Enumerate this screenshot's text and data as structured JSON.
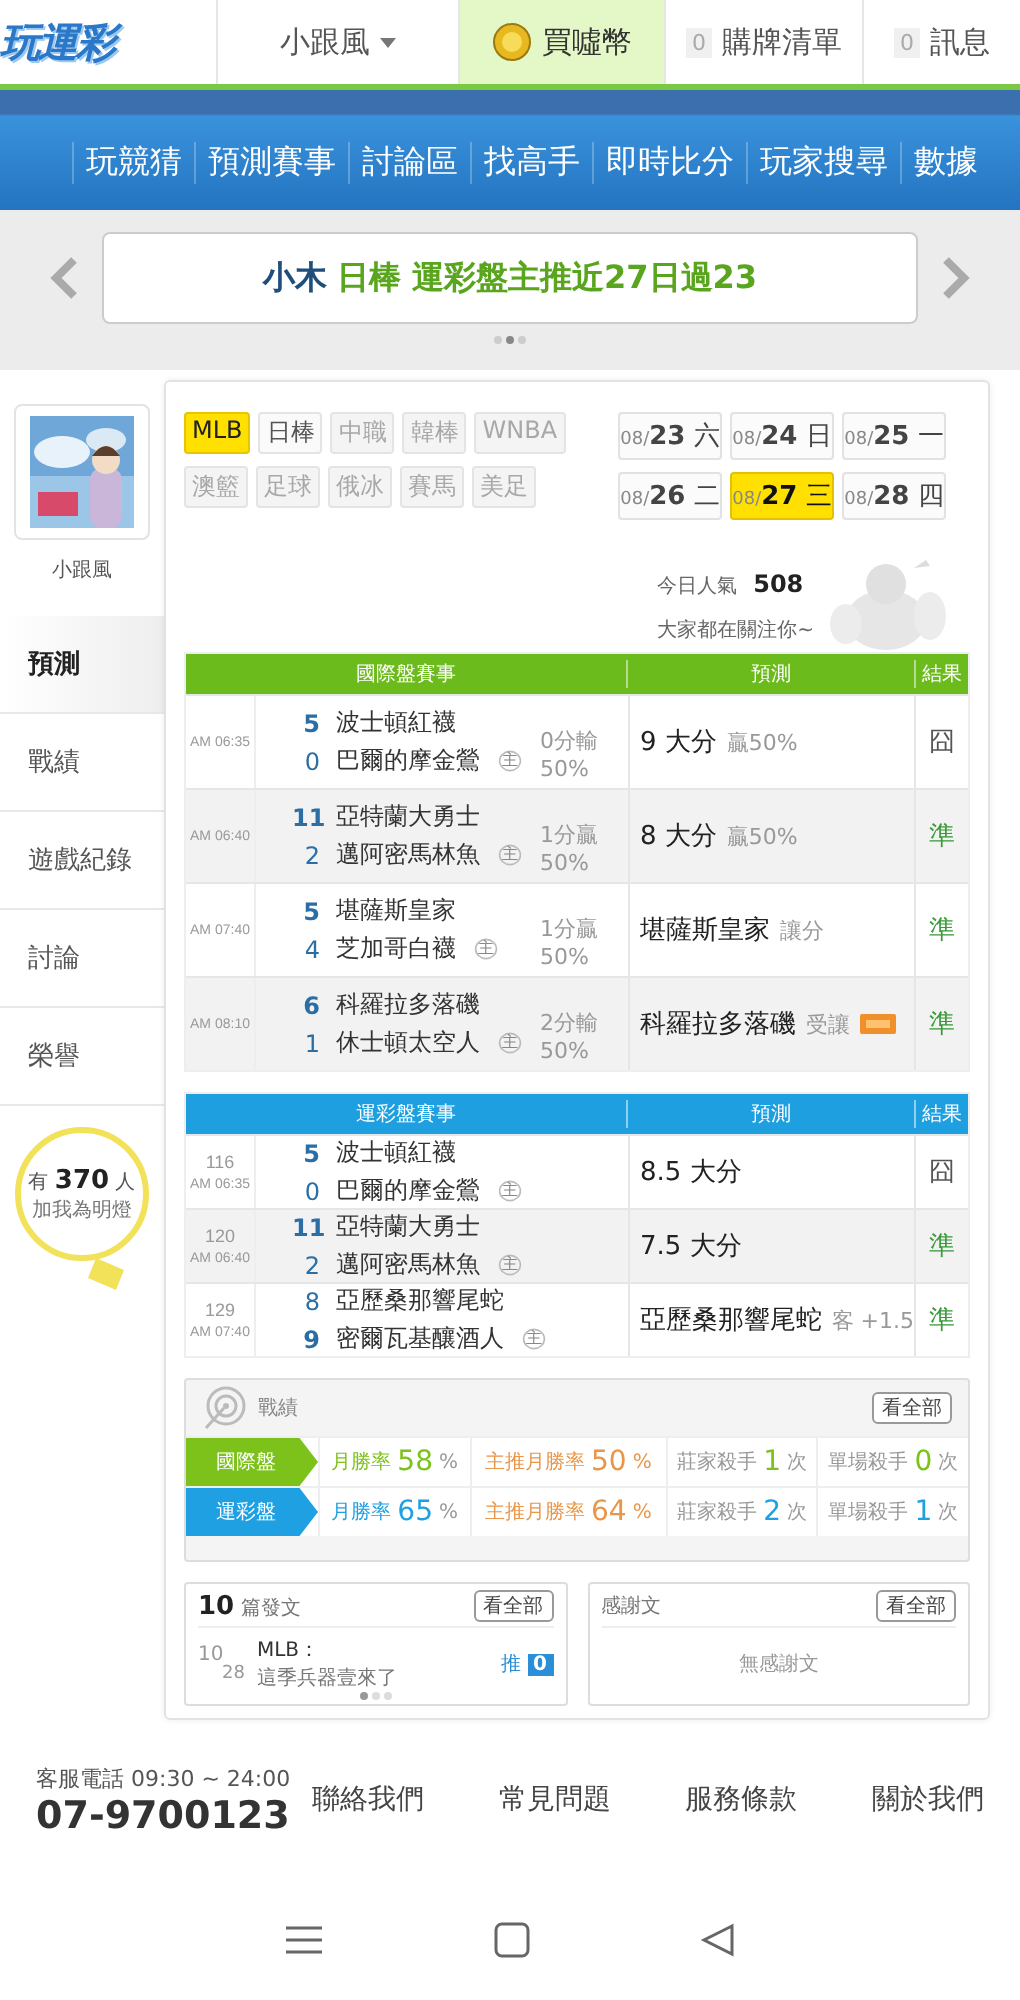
{
  "header": {
    "logo": "玩運彩",
    "user": "小跟風",
    "buy_coins": "買噓幣",
    "cart": {
      "count": "0",
      "label": "購牌清單"
    },
    "messages": {
      "count": "0",
      "label": "訊息"
    }
  },
  "nav": [
    "玩競猜",
    "預測賽事",
    "討論區",
    "找高手",
    "即時比分",
    "玩家搜尋",
    "數據"
  ],
  "banner": {
    "name": "小木",
    "text": "日棒 運彩盤主推近27日過23",
    "dots": [
      {
        "selected": false
      },
      {
        "selected": true
      },
      {
        "selected": false
      }
    ]
  },
  "profile": {
    "name": "小跟風",
    "menu": [
      {
        "label": "預測",
        "selected": true
      },
      {
        "label": "戰績",
        "selected": false
      },
      {
        "label": "遊戲紀錄",
        "selected": false
      },
      {
        "label": "討論",
        "selected": false
      },
      {
        "label": "榮譽",
        "selected": false
      }
    ],
    "fans": {
      "prefix": "有",
      "count": "370",
      "suffix": "人",
      "label": "加我為明燈"
    }
  },
  "sports": [
    {
      "label": "MLB",
      "selected": true,
      "disabled": false
    },
    {
      "label": "日棒",
      "selected": false,
      "disabled": false
    },
    {
      "label": "中職",
      "selected": false,
      "disabled": true
    },
    {
      "label": "韓棒",
      "selected": false,
      "disabled": true
    },
    {
      "label": "WNBA",
      "selected": false,
      "disabled": true
    },
    {
      "label": "澳籃",
      "selected": false,
      "disabled": true
    },
    {
      "label": "足球",
      "selected": false,
      "disabled": true
    },
    {
      "label": "俄冰",
      "selected": false,
      "disabled": true
    },
    {
      "label": "賽馬",
      "selected": false,
      "disabled": true
    },
    {
      "label": "美足",
      "selected": false,
      "disabled": true
    }
  ],
  "dates": [
    {
      "month": "08/",
      "day": "23",
      "weekday": "六",
      "selected": false
    },
    {
      "month": "08/",
      "day": "24",
      "weekday": "日",
      "selected": false
    },
    {
      "month": "08/",
      "day": "25",
      "weekday": "一",
      "selected": false
    },
    {
      "month": "08/",
      "day": "26",
      "weekday": "二",
      "selected": false
    },
    {
      "month": "08/",
      "day": "27",
      "weekday": "三",
      "selected": true
    },
    {
      "month": "08/",
      "day": "28",
      "weekday": "四",
      "selected": false
    }
  ],
  "popularity": {
    "label": "今日人氣",
    "count": "508",
    "note": "大家都在關注你~"
  },
  "intl_table": {
    "color": "#6cbb1c",
    "columns": [
      "國際盤賽事",
      "預測",
      "結果"
    ],
    "rows": [
      {
        "time": "AM 06:35",
        "teams": [
          {
            "score": "5",
            "name": "波士頓紅襪",
            "winner": true
          },
          {
            "score": "0",
            "name": "巴爾的摩金鶯",
            "winner": false,
            "home_mark": "主"
          }
        ],
        "line": "0分輸",
        "odds": "50%",
        "pick": "9 大分",
        "pick_note": "贏50%",
        "result": "囧",
        "correct": false
      },
      {
        "time": "AM 06:40",
        "teams": [
          {
            "score": "11",
            "name": "亞特蘭大勇士",
            "winner": true
          },
          {
            "score": "2",
            "name": "邁阿密馬林魚",
            "winner": false,
            "home_mark": "主"
          }
        ],
        "line": "1分贏",
        "odds": "50%",
        "pick": "8 大分",
        "pick_note": "贏50%",
        "result": "準",
        "correct": true
      },
      {
        "time": "AM 07:40",
        "teams": [
          {
            "score": "5",
            "name": "堪薩斯皇家",
            "winner": true
          },
          {
            "score": "4",
            "name": "芝加哥白襪",
            "winner": false,
            "home_mark": "主"
          }
        ],
        "line": "1分贏",
        "odds": "50%",
        "pick": "堪薩斯皇家",
        "pick_note": "讓分",
        "result": "準",
        "correct": true
      },
      {
        "time": "AM 08:10",
        "teams": [
          {
            "score": "6",
            "name": "科羅拉多落磯",
            "winner": true
          },
          {
            "score": "1",
            "name": "休士頓太空人",
            "winner": false,
            "home_mark": "主"
          }
        ],
        "line": "2分輸",
        "odds": "50%",
        "pick": "科羅拉多落磯",
        "pick_note": "受讓",
        "badge": true,
        "result": "準",
        "correct": true
      }
    ]
  },
  "lottery_table": {
    "color": "#1e9fe0",
    "columns": [
      "運彩盤賽事",
      "預測",
      "結果"
    ],
    "rows": [
      {
        "number": "116",
        "time": "AM 06:35",
        "teams": [
          {
            "score": "5",
            "name": "波士頓紅襪",
            "winner": true
          },
          {
            "score": "0",
            "name": "巴爾的摩金鶯",
            "winner": false,
            "home_mark": "主"
          }
        ],
        "pick": "8.5 大分",
        "result": "囧",
        "correct": false
      },
      {
        "number": "120",
        "time": "AM 06:40",
        "teams": [
          {
            "score": "11",
            "name": "亞特蘭大勇士",
            "winner": true
          },
          {
            "score": "2",
            "name": "邁阿密馬林魚",
            "winner": false,
            "home_mark": "主"
          }
        ],
        "pick": "7.5 大分",
        "result": "準",
        "correct": true
      },
      {
        "number": "129",
        "time": "AM 07:40",
        "teams": [
          {
            "score": "8",
            "name": "亞歷桑那響尾蛇",
            "winner": false
          },
          {
            "score": "9",
            "name": "密爾瓦基釀酒人",
            "winner": true,
            "home_mark": "主"
          }
        ],
        "pick": "亞歷桑那響尾蛇",
        "pick_note": "客 +1.5",
        "result": "準",
        "correct": true
      }
    ]
  },
  "stats": {
    "title": "戰績",
    "view_all": "看全部",
    "rows": [
      {
        "label": "國際盤",
        "color": "#7cc21a",
        "cells": [
          {
            "label": "月勝率",
            "value": "58",
            "unit": "%"
          },
          {
            "label": "主推月勝率",
            "value": "50",
            "unit": "%"
          },
          {
            "label": "莊家殺手",
            "value": "1",
            "unit": "次"
          },
          {
            "label": "單場殺手",
            "value": "0",
            "unit": "次"
          }
        ]
      },
      {
        "label": "運彩盤",
        "color": "#1ea0e2",
        "cells": [
          {
            "label": "月勝率",
            "value": "65",
            "unit": "%"
          },
          {
            "label": "主推月勝率",
            "value": "64",
            "unit": "%"
          },
          {
            "label": "莊家殺手",
            "value": "2",
            "unit": "次"
          },
          {
            "label": "單場殺手",
            "value": "1",
            "unit": "次"
          }
        ]
      }
    ]
  },
  "posts": {
    "count": "10",
    "label": "篇發文",
    "view_all": "看全部",
    "items": [
      {
        "day": "10",
        "sub": "28",
        "title": "MLB：",
        "text": "這季兵器壹來了",
        "push_label": "推",
        "push_count": "0"
      }
    ],
    "dots": [
      {
        "selected": true
      },
      {
        "selected": false
      },
      {
        "selected": false
      }
    ]
  },
  "thanks": {
    "title": "感謝文",
    "view_all": "看全部",
    "empty": "無感謝文"
  },
  "footer": {
    "phone_label": "客服電話 09:30 ~ 24:00",
    "phone": "07-9700123",
    "links": [
      "聯絡我們",
      "常見問題",
      "服務條款",
      "關於我們"
    ]
  }
}
